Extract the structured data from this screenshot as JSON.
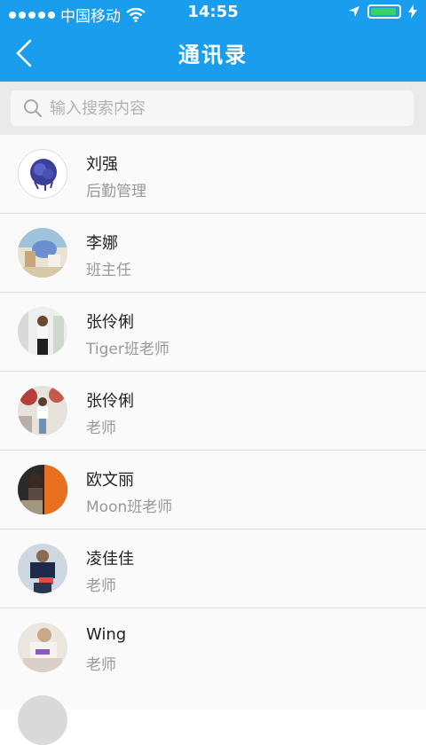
{
  "status_bar": {
    "carrier": "中国移动",
    "time": "14:55"
  },
  "header": {
    "title": "通讯录"
  },
  "search": {
    "placeholder": "输入搜索内容"
  },
  "contacts": [
    {
      "name": "刘强",
      "role": "后勤管理"
    },
    {
      "name": "李娜",
      "role": "班主任"
    },
    {
      "name": "张伶俐",
      "role": "Tiger班老师"
    },
    {
      "name": "张伶俐",
      "role": "老师"
    },
    {
      "name": "欧文丽",
      "role": "Moon班老师"
    },
    {
      "name": "凌佳佳",
      "role": "老师"
    },
    {
      "name": "Wing",
      "role": "老师"
    }
  ],
  "colors": {
    "header_bg": "#1a9ded",
    "battery": "#3bd16a",
    "search_bg": "#eaeaea"
  }
}
